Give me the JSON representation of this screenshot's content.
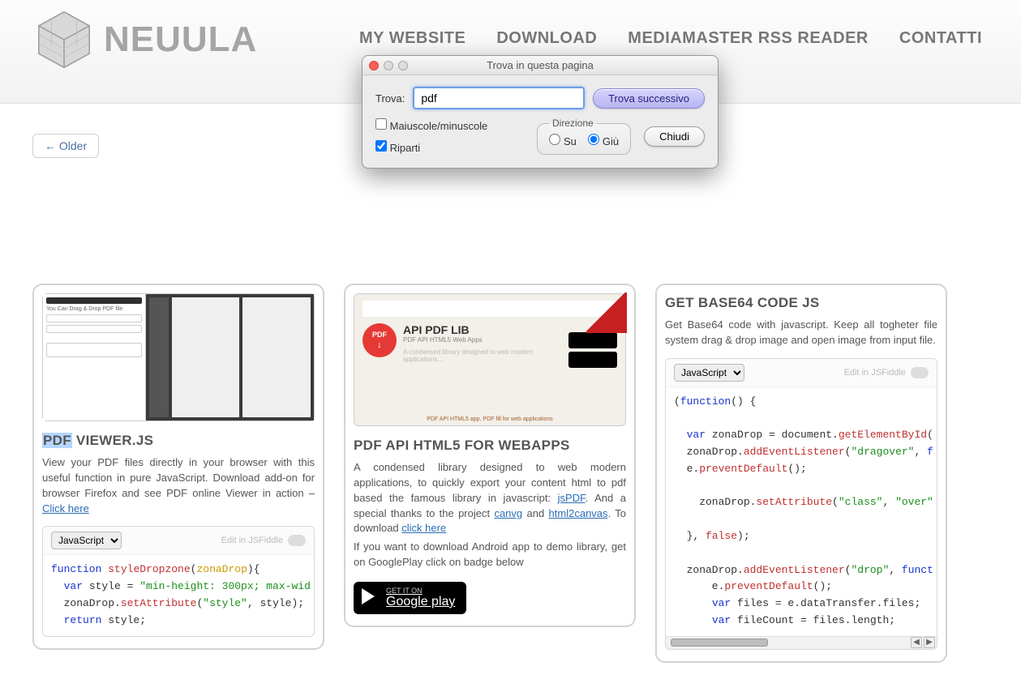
{
  "brand": {
    "name": "NEUULA"
  },
  "nav": {
    "mywebsite": "MY WEBSITE",
    "download": "DOWNLOAD",
    "rss": "MEDIAMASTER RSS READER",
    "contatti": "CONTATTI"
  },
  "older_btn": "← Older",
  "dialog": {
    "title": "Trova in questa pagina",
    "find_label": "Trova:",
    "find_value": "pdf",
    "next_btn": "Trova successivo",
    "close_btn": "Chiudi",
    "case_label": "Maiuscole/minuscole",
    "case_checked": false,
    "wrap_label": "Riparti",
    "wrap_checked": true,
    "direction_legend": "Direzione",
    "dir_up": "Su",
    "dir_down": "Giù",
    "dir_selected": "down"
  },
  "card1": {
    "title_hl": "PDF",
    "title_rest": " VIEWER.JS",
    "desc_pre": "View your PDF files directly in your browser with this useful function in pure JavaScript. Download add-on for browser Firefox and see PDF online Viewer in action – ",
    "desc_link": "Click here",
    "lang_selected": "JavaScript",
    "edit_label": "Edit in JSFiddle",
    "code": "function styleDropzone(zonaDrop){\n  var style = \"min-height: 300px; max-wid\n  zonaDrop.setAttribute(\"style\", style);\n  return style;"
  },
  "card2": {
    "thumb_title": "API PDF LIB",
    "thumb_sub": "PDF API HTML5 Web Apps",
    "title": "PDF API HTML5 FOR WEBAPPS",
    "para1_a": "A condensed library designed to web modern applications, to quickly export your content html to pdf based the famous library in javascript: ",
    "link_jspdf": "jsPDF",
    "para1_b": ". And a special thanks to the project ",
    "link_canvg": "canvg",
    "para1_c": " and ",
    "link_html2canvas": "html2canvas",
    "para1_d": ". To download ",
    "link_clickhere": "click here",
    "para2": "If you want to download Android app to demo library, get on GooglePlay click on badge below",
    "gplay_small": "GET IT ON",
    "gplay_big": "Google play"
  },
  "card3": {
    "title": "GET BASE64 CODE JS",
    "desc": "Get Base64 code with javascript. Keep all togheter file system drag & drop image and open image from input file.",
    "lang_selected": "JavaScript",
    "edit_label": "Edit in JSFiddle",
    "code": "(function() {\n\n  var zonaDrop = document.getElementById(\n  zonaDrop.addEventListener(\"dragover\", f\n  e.preventDefault();\n\n    zonaDrop.setAttribute(\"class\", \"over\"\n\n  }, false);\n\n  zonaDrop.addEventListener(\"drop\", funct\n      e.preventDefault();\n      var files = e.dataTransfer.files;\n      var fileCount = files.length;"
  }
}
